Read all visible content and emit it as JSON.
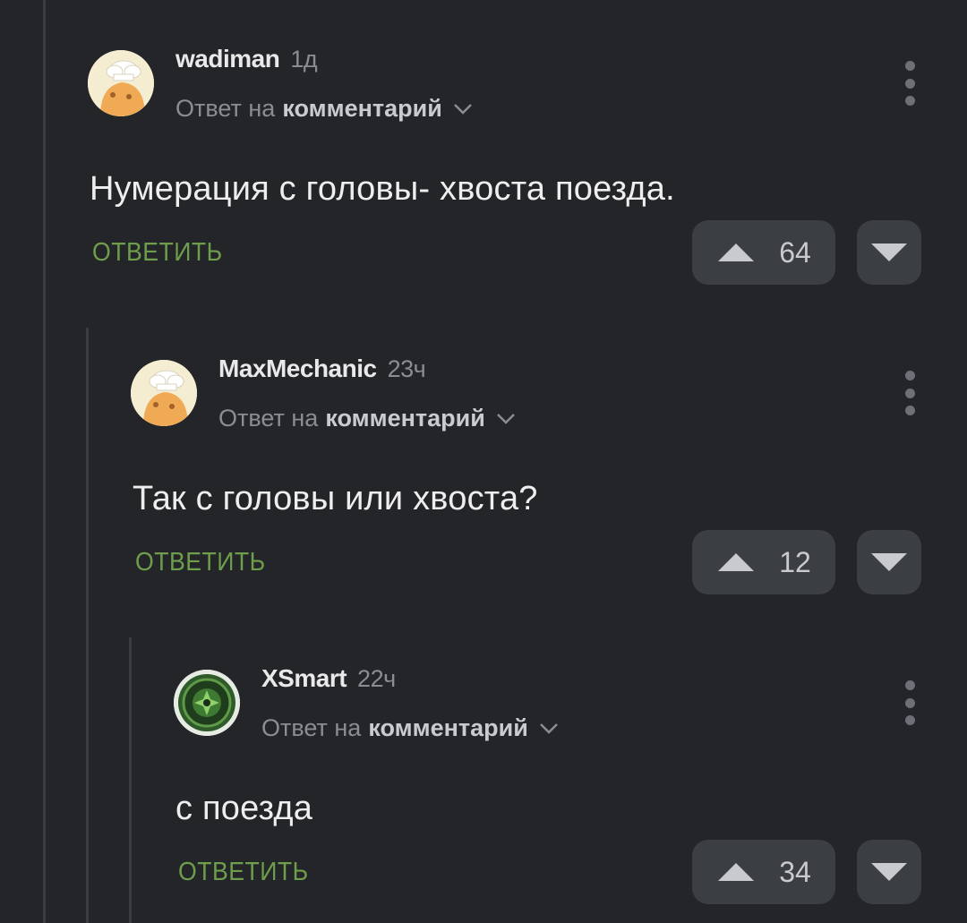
{
  "comments": [
    {
      "username": "wadiman",
      "time": "1д",
      "reply_prefix": "Ответ на",
      "reply_target": "комментарий",
      "text": "Нумерация с головы- хвоста поезда.",
      "reply_label": "ОТВЕТИТЬ",
      "votes": "64",
      "avatar_icon": "chef-avatar-icon"
    },
    {
      "username": "MaxMechanic",
      "time": "23ч",
      "reply_prefix": "Ответ на",
      "reply_target": "комментарий",
      "text": "Так с головы или хвоста?",
      "reply_label": "ОТВЕТИТЬ",
      "votes": "12",
      "avatar_icon": "chef-avatar-icon"
    },
    {
      "username": "XSmart",
      "time": "22ч",
      "reply_prefix": "Ответ на",
      "reply_target": "комментарий",
      "text": "с поезда",
      "reply_label": "ОТВЕТИТЬ",
      "votes": "34",
      "avatar_icon": "green-emblem-avatar-icon"
    }
  ],
  "colors": {
    "background": "#232529",
    "accent_green": "#6e9e4c",
    "button_bg": "#3b3e43",
    "muted_text": "#8a8d92"
  }
}
